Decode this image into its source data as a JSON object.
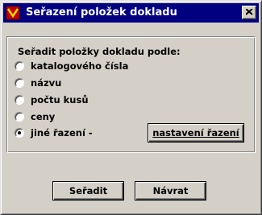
{
  "window": {
    "title": "Seřazení položek dokladu"
  },
  "group": {
    "caption": "Seřadit položky dokladu podle:",
    "options": [
      {
        "label": "katalogového čísla",
        "selected": false
      },
      {
        "label": "názvu",
        "selected": false
      },
      {
        "label": "počtu kusů",
        "selected": false
      },
      {
        "label": "ceny",
        "selected": false
      },
      {
        "label": "jiné řazení -",
        "selected": true
      }
    ],
    "sort_settings_label": "nastavení řazení"
  },
  "buttons": {
    "ok_label": "Seřadit",
    "back_label": "Návrat"
  }
}
